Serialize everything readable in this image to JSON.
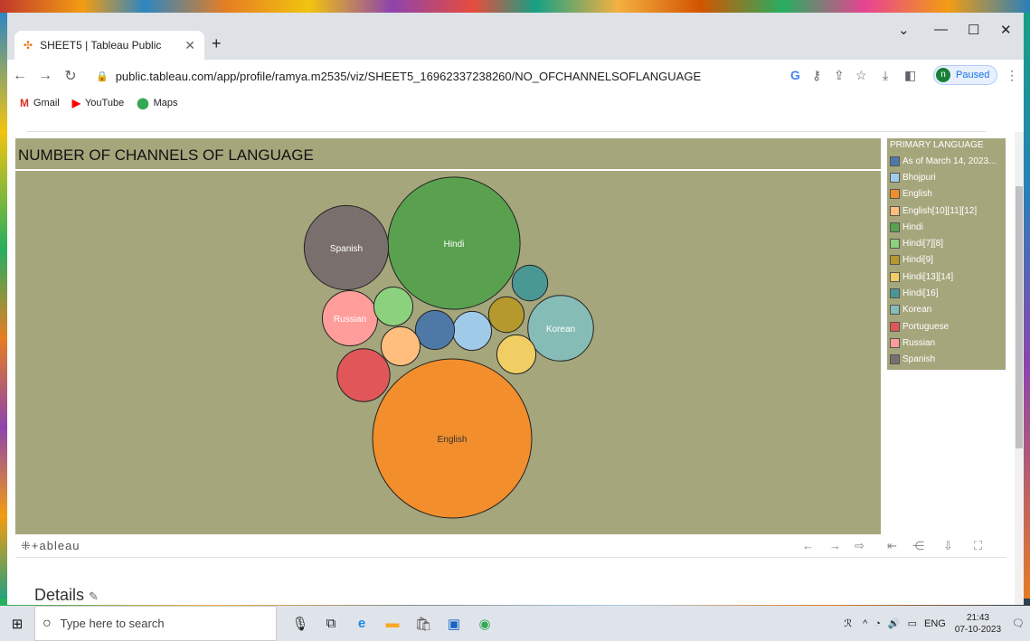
{
  "browser": {
    "tab_title": "SHEET5 | Tableau Public",
    "url": "public.tableau.com/app/profile/ramya.m2535/viz/SHEET5_16962337238260/NO_OFCHANNELSOFLANGUAGE",
    "profile_initial": "n",
    "profile_status": "Paused",
    "bookmarks": [
      "Gmail",
      "YouTube",
      "Maps"
    ]
  },
  "viz": {
    "title": "NUMBER OF CHANNELS OF LANGUAGE",
    "legend_title": "PRIMARY LANGUAGE",
    "legend": [
      {
        "label": "As of March 14, 2023...",
        "color": "#4e79a7"
      },
      {
        "label": "Bhojpuri",
        "color": "#a0cbe8"
      },
      {
        "label": "English",
        "color": "#f28e2b"
      },
      {
        "label": "English[10][11][12]",
        "color": "#ffbe7d"
      },
      {
        "label": "Hindi",
        "color": "#59a14f"
      },
      {
        "label": "Hindi[7][8]",
        "color": "#8cd17d"
      },
      {
        "label": "Hindi[9]",
        "color": "#b6992d"
      },
      {
        "label": "Hindi[13][14]",
        "color": "#f1ce63"
      },
      {
        "label": "Hindi[16]",
        "color": "#499894"
      },
      {
        "label": "Korean",
        "color": "#86bcb6"
      },
      {
        "label": "Portuguese",
        "color": "#e15759"
      },
      {
        "label": "Russian",
        "color": "#ff9d9a"
      },
      {
        "label": "Spanish",
        "color": "#79706e"
      }
    ],
    "logo_text": "+ableau"
  },
  "chart_data": {
    "type": "bubble",
    "title": "NUMBER OF CHANNELS OF LANGUAGE",
    "color_legend": "PRIMARY LANGUAGE",
    "bubbles": [
      {
        "category": "English",
        "label": "English",
        "size": 100,
        "color": "#f28e2b"
      },
      {
        "category": "Hindi",
        "label": "Hindi",
        "size": 69,
        "color": "#59a14f"
      },
      {
        "category": "Spanish",
        "label": "Spanish",
        "size": 28,
        "color": "#79706e"
      },
      {
        "category": "Korean",
        "label": "Korean",
        "size": 17,
        "color": "#86bcb6"
      },
      {
        "category": "Russian",
        "label": "Russian",
        "size": 12,
        "color": "#ff9d9a"
      },
      {
        "category": "Portuguese",
        "label": "",
        "size": 11,
        "color": "#e15759"
      },
      {
        "category": "Hindi[13][14]",
        "label": "",
        "size": 6,
        "color": "#f1ce63"
      },
      {
        "category": "Hindi[16]",
        "label": "",
        "size": 5,
        "color": "#499894"
      },
      {
        "category": "Hindi[7][8]",
        "label": "",
        "size": 6,
        "color": "#8cd17d"
      },
      {
        "category": "Bhojpuri",
        "label": "",
        "size": 6,
        "color": "#a0cbe8"
      },
      {
        "category": "As of March 14, 2023...",
        "label": "",
        "size": 6,
        "color": "#4e79a7"
      },
      {
        "category": "English[10][11][12]",
        "label": "",
        "size": 6,
        "color": "#ffbe7d"
      },
      {
        "category": "Hindi[9]",
        "label": "",
        "size": 5,
        "color": "#b6992d"
      }
    ]
  },
  "page": {
    "details_heading": "Details"
  },
  "taskbar": {
    "search_placeholder": "Type here to search",
    "lang": "ENG",
    "time": "21:43",
    "date": "07-10-2023"
  }
}
